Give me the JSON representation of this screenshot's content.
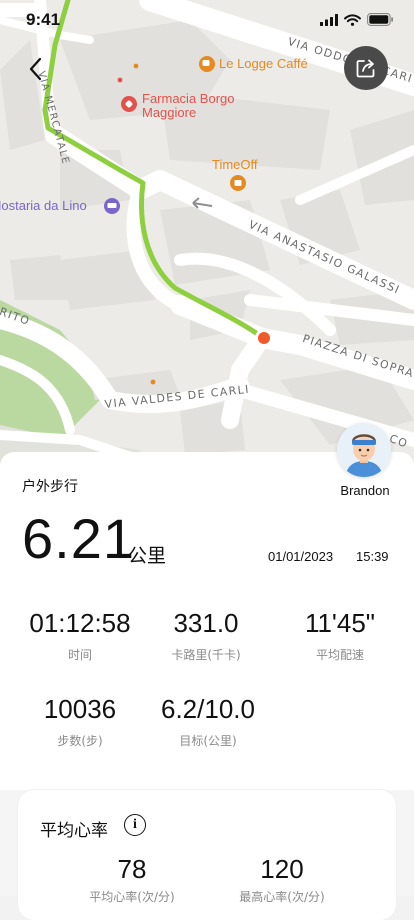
{
  "status_bar": {
    "time": "9:41"
  },
  "map": {
    "streets": [
      "VIA ODDONE SCARITO",
      "VIA ANASTASIO GALASSI",
      "PIAZZA DI SOPRA",
      "VIA VALDES DE CARLI",
      "VIA MERCATALE",
      "RITO",
      "CO"
    ],
    "pois": [
      "Le Logge Caffé",
      "Farmacia Borgo",
      "Maggiore",
      "TimeOff",
      "Hostaria da Lino"
    ]
  },
  "summary": {
    "activity_type": "户外步行",
    "username": "Brandon",
    "distance": "6.21",
    "distance_unit": "公里",
    "date": "01/01/2023",
    "time": "15:39"
  },
  "stats": [
    {
      "value": "01:12:58",
      "label": "时间"
    },
    {
      "value": "331.0",
      "label": "卡路里(千卡)"
    },
    {
      "value": "11'45\"",
      "label": "平均配速"
    },
    {
      "value": "10036",
      "label": "步数(步)"
    },
    {
      "value": "6.2/10.0",
      "label": "目标(公里)"
    }
  ],
  "heart_rate": {
    "title": "平均心率",
    "info_glyph": "i",
    "values": [
      {
        "value": "78",
        "label": "平均心率(次/分)"
      },
      {
        "value": "120",
        "label": "最高心率(次/分)"
      }
    ]
  },
  "colors": {
    "route": "#8dcf3f",
    "marker": "#f05a28",
    "poi_orange": "#e58a22",
    "poi_red": "#e2524d",
    "poi_purple": "#7b66c9"
  }
}
